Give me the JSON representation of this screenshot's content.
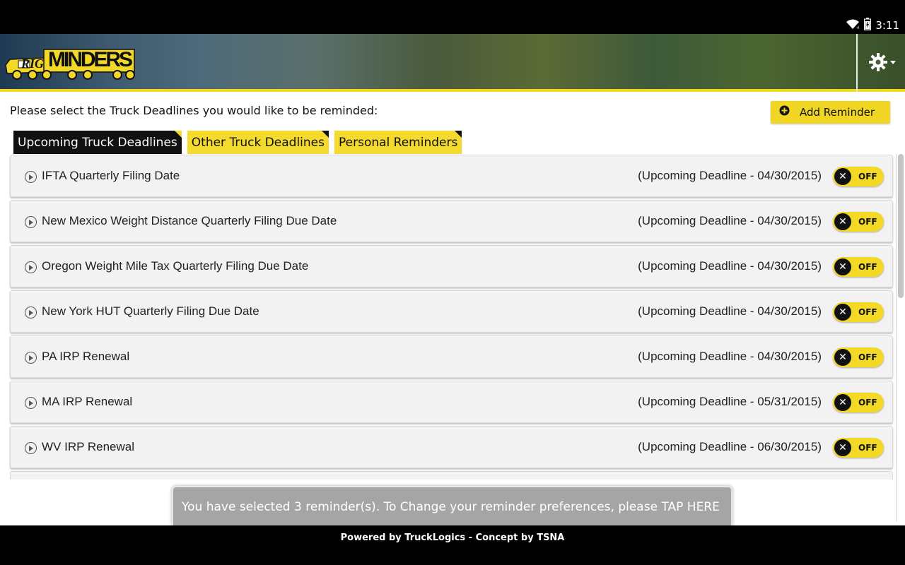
{
  "status_bar": {
    "time": "3:11",
    "icons": [
      "wifi-icon",
      "battery-icon"
    ]
  },
  "header": {
    "logo_text": "RIGMINDERS",
    "settings_icon": "gear-icon",
    "colors": {
      "accent": "#f2d81c"
    }
  },
  "main": {
    "prompt": "Please select the Truck Deadlines you would like to be reminded:",
    "add_reminder_label": "Add Reminder",
    "tabs": [
      {
        "label": "Upcoming Truck Deadlines",
        "active": true
      },
      {
        "label": "Other Truck Deadlines",
        "active": false
      },
      {
        "label": "Personal Reminders",
        "active": false
      }
    ],
    "reminders": [
      {
        "title": "IFTA Quarterly Filing Date",
        "deadline": "(Upcoming Deadline - 04/30/2015)",
        "toggle": "OFF"
      },
      {
        "title": "New Mexico Weight Distance Quarterly Filing Due Date",
        "deadline": "(Upcoming Deadline - 04/30/2015)",
        "toggle": "OFF"
      },
      {
        "title": "Oregon Weight Mile Tax Quarterly Filing Due Date",
        "deadline": "(Upcoming Deadline - 04/30/2015)",
        "toggle": "OFF"
      },
      {
        "title": "New York HUT Quarterly Filing Due Date",
        "deadline": "(Upcoming Deadline - 04/30/2015)",
        "toggle": "OFF"
      },
      {
        "title": "PA IRP Renewal",
        "deadline": "(Upcoming Deadline - 04/30/2015)",
        "toggle": "OFF"
      },
      {
        "title": "MA IRP Renewal",
        "deadline": "(Upcoming Deadline - 05/31/2015)",
        "toggle": "OFF"
      },
      {
        "title": "WV IRP Renewal",
        "deadline": "(Upcoming Deadline - 06/30/2015)",
        "toggle": "OFF"
      }
    ],
    "toggle_knob_symbol": "✕",
    "banner_text": "You have selected 3 reminder(s). To Change your reminder preferences, please TAP HERE"
  },
  "footer": {
    "text": "Powered by TruckLogics - Concept by TSNA"
  }
}
